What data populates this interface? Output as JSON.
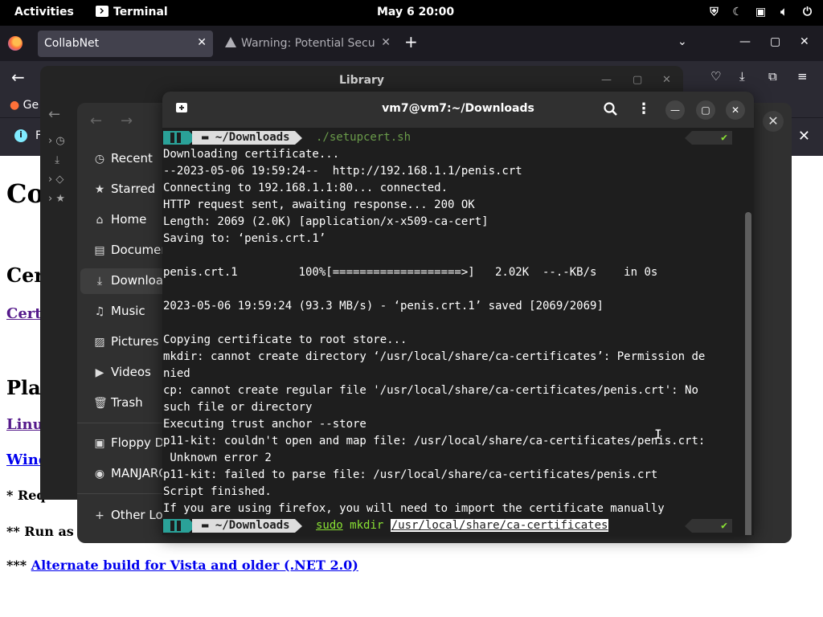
{
  "topbar": {
    "activities": "Activities",
    "app_name": "Terminal",
    "clock": "May 6  20:00"
  },
  "firefox": {
    "active_tab": "CollabNet",
    "inactive_tab": "Warning: Potential Secu",
    "bookmark": "Ge",
    "notif_partial": "Fi"
  },
  "webpage": {
    "heading": "Co",
    "section1": "Cer",
    "link1": "Cert",
    "section2": "Plat",
    "link_linux": "Linu",
    "link_windows": "Wind",
    "note1": "* Require",
    "note2": "** Run as a",
    "footer_prefix": "*** ",
    "footer_link": "Alternate build for Vista and older (.NET 2.0)"
  },
  "library": {
    "title": "Library"
  },
  "files": {
    "sidebar": [
      {
        "label": "Recent",
        "icon": "clock-icon"
      },
      {
        "label": "Starred",
        "icon": "star-icon"
      },
      {
        "label": "Home",
        "icon": "home-icon"
      },
      {
        "label": "Documents",
        "icon": "document-icon"
      },
      {
        "label": "Downloads",
        "icon": "download-icon"
      },
      {
        "label": "Music",
        "icon": "music-icon"
      },
      {
        "label": "Pictures",
        "icon": "picture-icon"
      },
      {
        "label": "Videos",
        "icon": "video-icon"
      },
      {
        "label": "Trash",
        "icon": "trash-icon"
      },
      {
        "label": "Floppy Disk",
        "icon": "floppy-icon"
      },
      {
        "label": "MANJARO",
        "icon": "disc-icon"
      },
      {
        "label": "Other Locations",
        "icon": "plus-icon"
      }
    ]
  },
  "terminal": {
    "title": "vm7@vm7:~/Downloads",
    "prompt_dir": "~/Downloads",
    "prompt_check": "✔",
    "cmd1": "./setupcert.sh",
    "lines": [
      "Downloading certificate...",
      "--2023-05-06 19:59:24--  http://192.168.1.1/penis.crt",
      "Connecting to 192.168.1.1:80... connected.",
      "HTTP request sent, awaiting response... 200 OK",
      "Length: 2069 (2.0K) [application/x-x509-ca-cert]",
      "Saving to: ‘penis.crt.1’",
      "",
      "penis.crt.1         100%[===================>]   2.02K  --.-KB/s    in 0s",
      "",
      "2023-05-06 19:59:24 (93.3 MB/s) - ‘penis.crt.1’ saved [2069/2069]",
      "",
      "Copying certificate to root store...",
      "mkdir: cannot create directory ‘/usr/local/share/ca-certificates’: Permission de",
      "nied",
      "cp: cannot create regular file '/usr/local/share/ca-certificates/penis.crt': No",
      "such file or directory",
      "Executing trust anchor --store",
      "p11-kit: couldn't open and map file: /usr/local/share/ca-certificates/penis.crt:",
      " Unknown error 2",
      "p11-kit: failed to parse file: /usr/local/share/ca-certificates/penis.crt",
      "Script finished.",
      "If you are using firefox, you will need to import the certificate manually"
    ],
    "cmd2_sudo": "sudo",
    "cmd2_mkdir": "mkdir",
    "cmd2_arg": "/usr/local/share/ca-certificates"
  }
}
